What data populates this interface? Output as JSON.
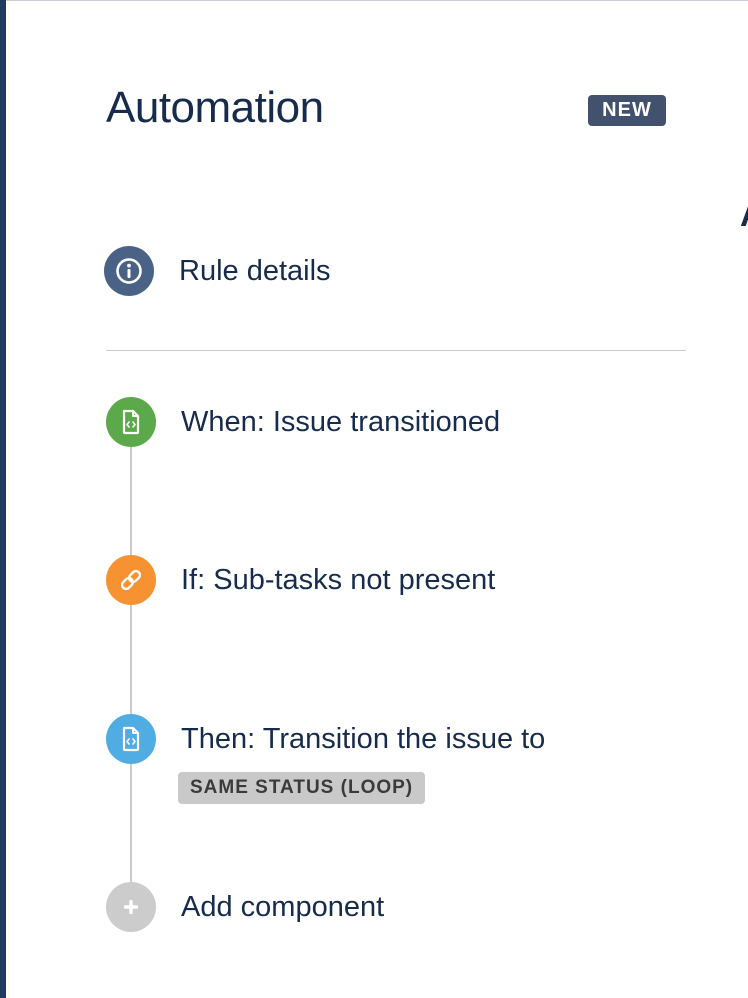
{
  "header": {
    "title": "Automation",
    "badge": "NEW"
  },
  "rule_details": {
    "label": "Rule details",
    "icon": "info-icon"
  },
  "steps": [
    {
      "label": "When: Issue transitioned",
      "icon": "issue-code-icon",
      "color": "#5ba94a"
    },
    {
      "label": "If: Sub-tasks not present",
      "icon": "link-icon",
      "color": "#f79232"
    },
    {
      "label": "Then: Transition the issue to",
      "icon": "issue-code-icon",
      "color": "#4fade3",
      "status": "SAME STATUS (LOOP)"
    },
    {
      "label": "Add component",
      "icon": "plus-icon",
      "color": "#cccccc"
    }
  ],
  "colors": {
    "sidebar": "#213a5f",
    "title_text": "#172b4d",
    "badge": "#42526e"
  }
}
